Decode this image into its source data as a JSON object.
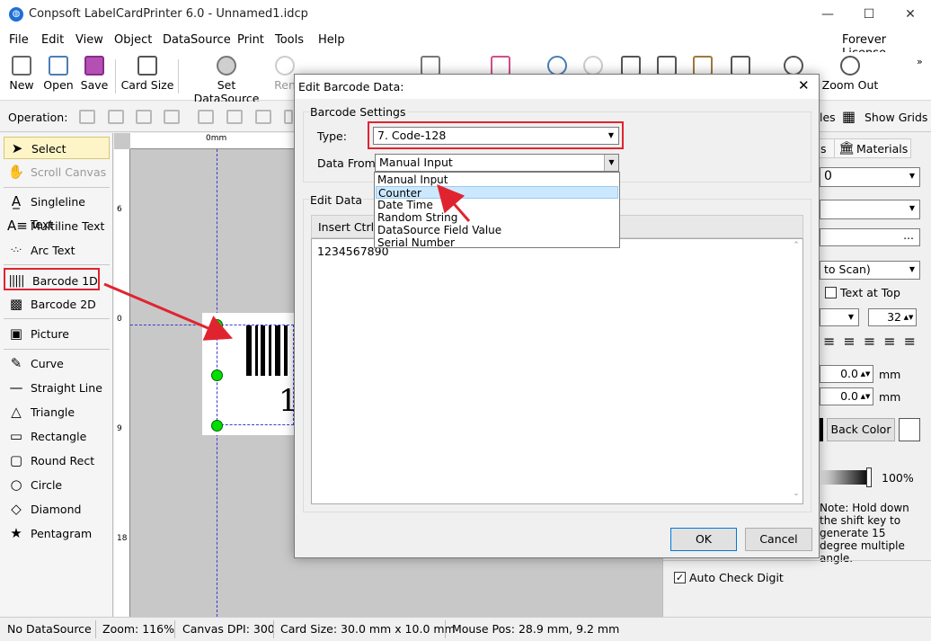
{
  "window": {
    "title": "Conpsoft LabelCardPrinter 6.0 - Unnamed1.idcp"
  },
  "menu": {
    "items": [
      "File",
      "Edit",
      "View",
      "Object",
      "DataSource",
      "Print",
      "Tools",
      "Help"
    ],
    "license": "Forever License"
  },
  "toolbar": {
    "new": "New",
    "open": "Open",
    "save": "Save",
    "card_size": "Card Size",
    "set_datasource": "Set DataSource",
    "rename_partial": "Ren",
    "zoom_out": "Zoom Out"
  },
  "opbar": {
    "label": "Operation:",
    "rules_partial": "les",
    "show_grids": "Show Grids"
  },
  "tools": {
    "select": "Select",
    "scroll_canvas": "Scroll Canvas",
    "singleline_text": "Singleline Text",
    "multiline_text": "Multiline Text",
    "arc_text": "Arc Text",
    "barcode_1d": "Barcode 1D",
    "barcode_2d": "Barcode 2D",
    "picture": "Picture",
    "curve": "Curve",
    "straight_line": "Straight Line",
    "triangle": "Triangle",
    "rectangle": "Rectangle",
    "round_rect": "Round Rect",
    "circle": "Circle",
    "diamond": "Diamond",
    "pentagram": "Pentagram"
  },
  "ruler": {
    "h0": "0mm",
    "v6": "6",
    "v0": "0",
    "v9": "9",
    "v18": "18"
  },
  "canvas": {
    "barcode_digit": "1"
  },
  "right": {
    "tab_partial": "s",
    "tab_materials": "Materials",
    "combo1": "0",
    "scan_combo": "to Scan)",
    "text_at_top": "Text at Top",
    "font_size": "32",
    "offset1": "0.0",
    "offset2": "0.0",
    "unit": "mm",
    "back_color": "Back Color",
    "opacity": "100%",
    "note": "Note: Hold down the shift key to generate 15 degree multiple angle.",
    "auto_check_digit": "Auto Check Digit"
  },
  "status": {
    "datasource": "No DataSource",
    "zoom": "Zoom: 116%",
    "dpi": "Canvas DPI: 300",
    "card_size": "Card Size: 30.0 mm x 10.0 mm",
    "mouse_pos": "Mouse Pos: 28.9 mm, 9.2 mm"
  },
  "dialog": {
    "title": "Edit Barcode Data:",
    "settings_group": "Barcode Settings",
    "type_label": "Type:",
    "type_value": "7.  Code-128",
    "data_from_label": "Data From:",
    "data_from_value": "Manual Input",
    "options": [
      "Manual Input",
      "Counter",
      "Date Time",
      "Random String",
      "DataSource Field Value",
      "Serial Number"
    ],
    "edit_group": "Edit Data",
    "insert_ctrl": "Insert Ctrl C",
    "data_text": "1234567890",
    "ok": "OK",
    "cancel": "Cancel"
  },
  "colors": {
    "highlight_red": "#e0242f",
    "selection_blue": "#cce8ff",
    "handle_green": "#00e000"
  }
}
